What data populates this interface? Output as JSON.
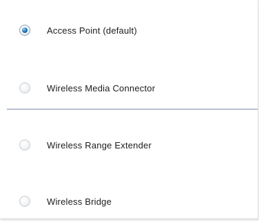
{
  "options": [
    {
      "label": "Access Point (default)",
      "selected": true
    },
    {
      "label": "Wireless Media Connector",
      "selected": false
    },
    {
      "label": "Wireless Range Extender",
      "selected": false
    },
    {
      "label": "Wireless Bridge",
      "selected": false
    }
  ],
  "colors": {
    "divider": "#b9bfd4",
    "radio_selected": "#2f7fc0"
  }
}
